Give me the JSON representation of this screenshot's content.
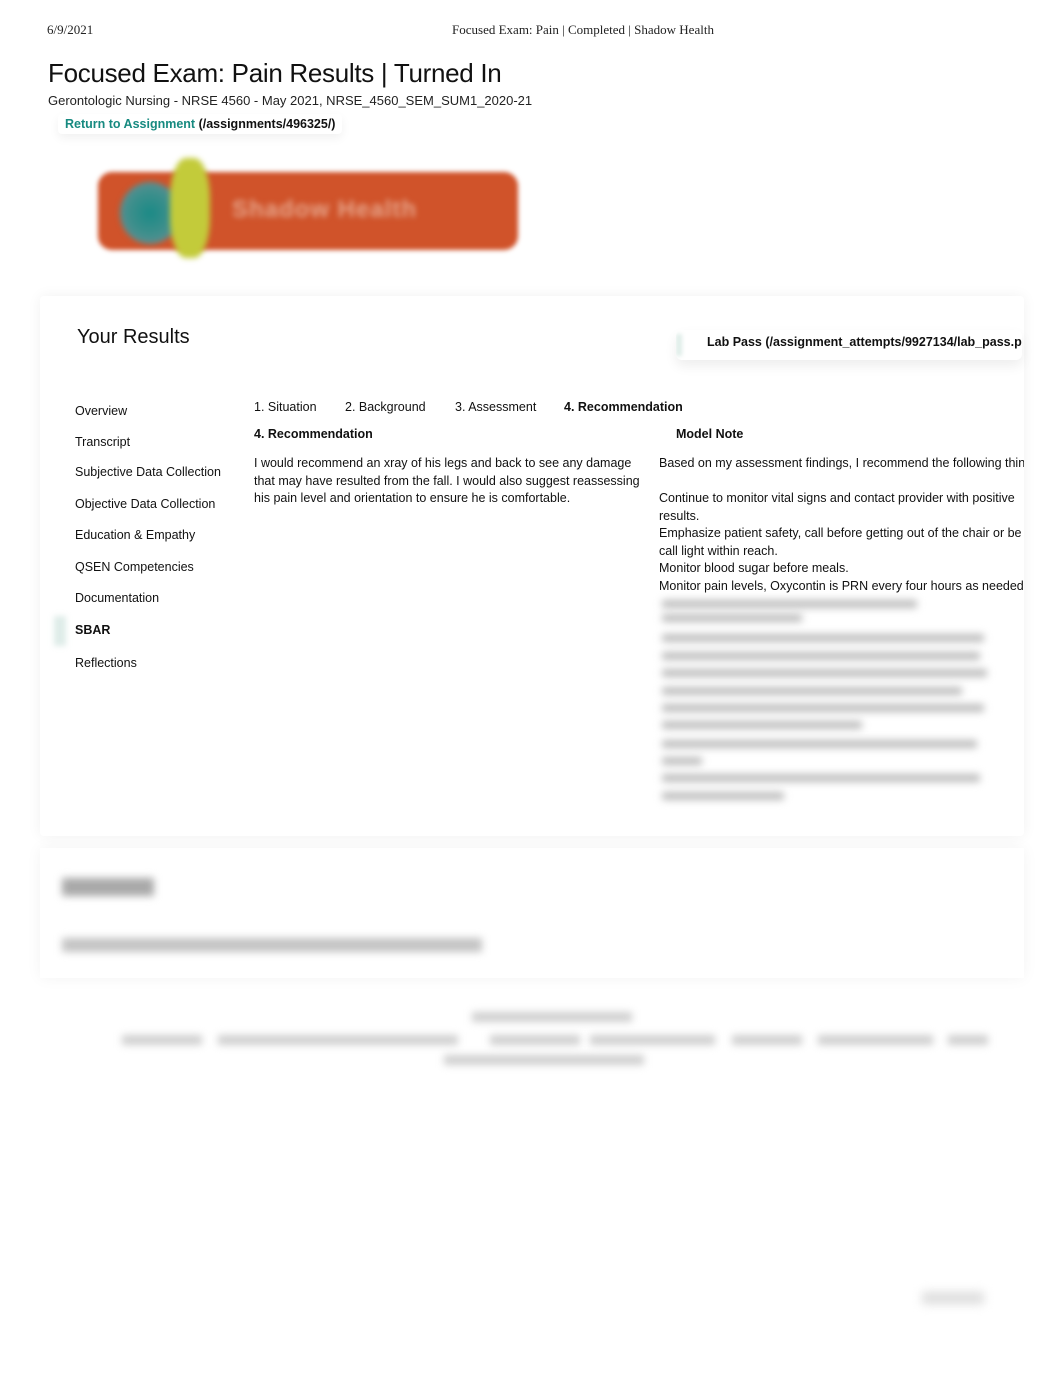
{
  "print_header": {
    "date": "6/9/2021",
    "title": "Focused Exam: Pain | Completed | Shadow Health"
  },
  "page": {
    "title": "Focused Exam: Pain Results | Turned In",
    "course": "Gerontologic Nursing - NRSE 4560 - May 2021, NRSE_4560_SEM_SUM1_2020-21",
    "return_link_label": "Return to Assignment",
    "return_link_path": "(/assignments/496325/)",
    "logo_text": "Shadow Health"
  },
  "results": {
    "title": "Your Results",
    "lab_pass_label": "Lab Pass (/assignment_attempts/9927134/lab_pass.pd"
  },
  "sidebar": {
    "items": [
      {
        "label": "Overview",
        "active": false
      },
      {
        "label": "Transcript",
        "active": false
      },
      {
        "label": "Subjective Data Collection",
        "active": false
      },
      {
        "label": "Objective Data Collection",
        "active": false
      },
      {
        "label": "Education & Empathy",
        "active": false
      },
      {
        "label": "QSEN Competencies",
        "active": false
      },
      {
        "label": "Documentation",
        "active": false
      },
      {
        "label": "SBAR",
        "active": true
      },
      {
        "label": "Reflections",
        "active": false
      }
    ]
  },
  "tabs": [
    {
      "label": "1. Situation",
      "active": false
    },
    {
      "label": "2. Background",
      "active": false
    },
    {
      "label": "3. Assessment",
      "active": false
    },
    {
      "label": "4. Recommendation",
      "active": true
    }
  ],
  "content": {
    "student_heading": "4. Recommendation",
    "student_text": "I would recommend an xray of his legs and back to see any damage that may have resulted from the fall. I would also suggest reassessing his pain level and orientation to ensure he is comfortable.",
    "model_heading": "Model Note",
    "model_lines": [
      "Based on my assessment findings, I recommend the following thin",
      "",
      "Continue to monitor vital signs and contact provider with positive",
      "results.",
      "Emphasize patient safety, call before getting out of the chair or be",
      "call light within reach.",
      "Monitor blood sugar before meals.",
      "Monitor pain levels, Oxycontin is PRN every four hours as needed"
    ]
  }
}
